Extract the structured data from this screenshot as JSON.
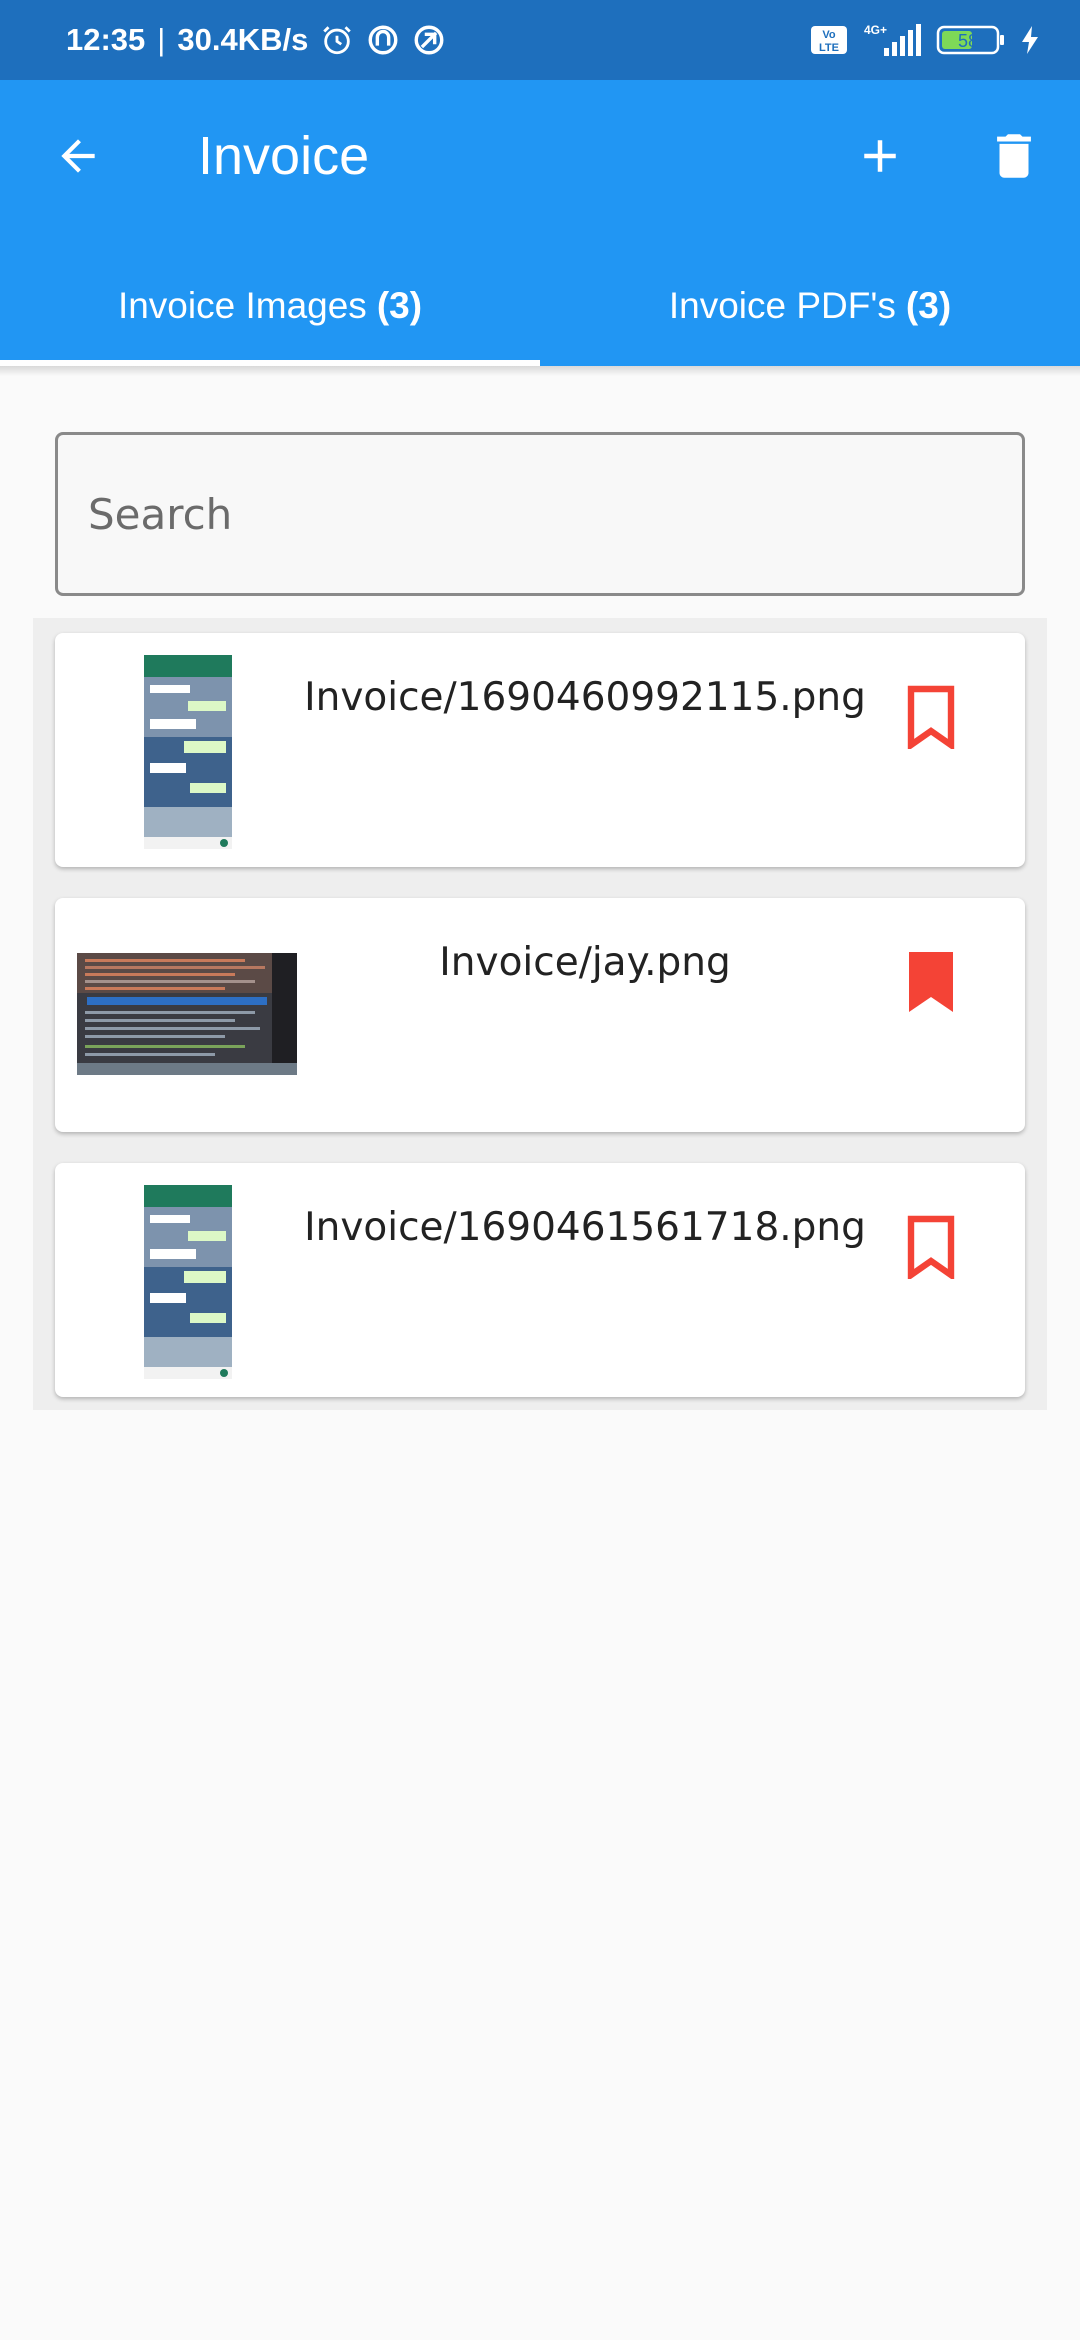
{
  "status_bar": {
    "time": "12:35",
    "separator": "|",
    "speed": "30.4KB/s",
    "icons": [
      "alarm-icon",
      "app-notification-icon",
      "app-notification-icon-2"
    ],
    "network": "4G+",
    "volte": "Vo LTE",
    "battery": "58"
  },
  "app_bar": {
    "title": "Invoice",
    "back_icon": "arrow-back-icon",
    "add_icon": "plus-icon",
    "delete_icon": "trash-icon",
    "color": "#2196f3"
  },
  "tabs": [
    {
      "label": "Invoice Images",
      "count": "(3)",
      "selected": true
    },
    {
      "label": "Invoice PDF's",
      "count": "(3)",
      "selected": false
    }
  ],
  "search": {
    "placeholder": "Search",
    "value": ""
  },
  "files": [
    {
      "name": "Invoice/1690460992115.png",
      "thumbnail": "portrait-chat-screenshot",
      "bookmarked": false
    },
    {
      "name": "Invoice/jay.png",
      "thumbnail": "landscape-code-screenshot",
      "bookmarked": true
    },
    {
      "name": "Invoice/1690461561718.png",
      "thumbnail": "portrait-chat-screenshot",
      "bookmarked": false
    }
  ],
  "colors": {
    "accent": "#2196f3",
    "status_bar": "#1e6fbd",
    "bookmark": "#f44336"
  }
}
